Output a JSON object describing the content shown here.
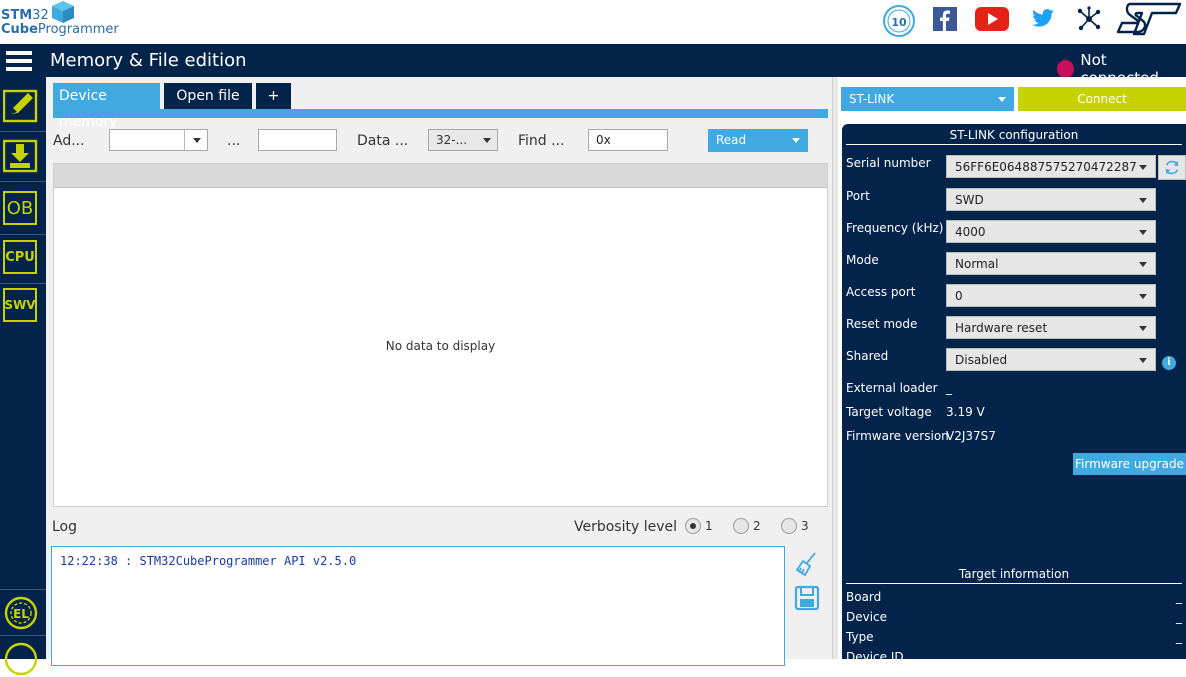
{
  "brand": {
    "line1_bold": "STM",
    "line1_thin": "32",
    "line2_bold": "Cube",
    "line2_thin": "Programmer"
  },
  "social": [
    "anniversary-badge-icon",
    "facebook-icon",
    "youtube-icon",
    "twitter-icon",
    "community-icon",
    "st-logo-icon"
  ],
  "header": {
    "title": "Memory & File edition",
    "status": "Not connected",
    "status_color": "#c8105a"
  },
  "nav": {
    "items": [
      {
        "name": "memory-edit-icon",
        "label": ""
      },
      {
        "name": "download-icon",
        "label": ""
      },
      {
        "name": "ob",
        "label": "OB"
      },
      {
        "name": "cpu",
        "label": "CPU"
      },
      {
        "name": "swv",
        "label": "SWV"
      }
    ],
    "bottom": [
      "el-icon",
      "beta-icon"
    ]
  },
  "tabs": [
    {
      "label": "Device memory",
      "active": true
    },
    {
      "label": "Open file",
      "active": false
    },
    {
      "label": "+",
      "active": false
    }
  ],
  "toolbar": {
    "address_label": "Ad...",
    "address_value": "",
    "size_label": "...",
    "size_value": "",
    "data_label": "Data ...",
    "data_width": "32-...",
    "find_label": "Find ...",
    "find_value": "0x",
    "read_label": "Read"
  },
  "grid": {
    "empty_text": "No data to display"
  },
  "log": {
    "title": "Log",
    "verbosity_label": "Verbosity level",
    "levels": [
      "1",
      "2",
      "3"
    ],
    "selected_level": "1",
    "lines": [
      "12:22:38 : STM32CubeProgrammer API v2.5.0"
    ]
  },
  "right": {
    "probe": "ST-LINK",
    "connect_label": "Connect",
    "config_title": "ST-LINK configuration",
    "fields": [
      {
        "label": "Serial number",
        "value": "56FF6E064887575270472287"
      },
      {
        "label": "Port",
        "value": "SWD"
      },
      {
        "label": "Frequency (kHz)",
        "value": "4000"
      },
      {
        "label": "Mode",
        "value": "Normal"
      },
      {
        "label": "Access port",
        "value": "0"
      },
      {
        "label": "Reset mode",
        "value": "Hardware reset"
      },
      {
        "label": "Shared",
        "value": "Disabled"
      }
    ],
    "info": [
      {
        "label": "External loader",
        "value": "_"
      },
      {
        "label": "Target voltage",
        "value": "3.19 V"
      },
      {
        "label": "Firmware version",
        "value": "V2J37S7"
      }
    ],
    "firmware_upgrade": "Firmware upgrade",
    "target_title": "Target information",
    "target": [
      {
        "label": "Board",
        "value": "_"
      },
      {
        "label": "Device",
        "value": "_"
      },
      {
        "label": "Type",
        "value": "_"
      },
      {
        "label": "Device ID",
        "value": "_"
      }
    ]
  },
  "colors": {
    "navy": "#03234b",
    "accent_blue": "#3fa9e0",
    "lime": "#c6d300"
  }
}
